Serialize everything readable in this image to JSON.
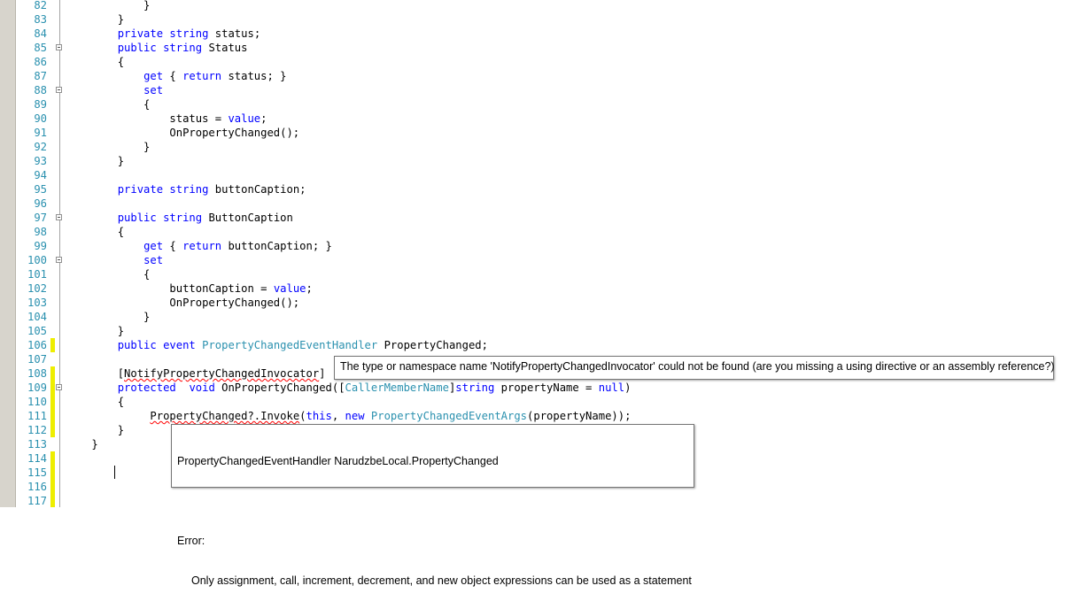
{
  "editor": {
    "lines": [
      {
        "n": "82",
        "s": [
          {
            "t": "            }"
          }
        ]
      },
      {
        "n": "83",
        "s": [
          {
            "t": "        }"
          }
        ]
      },
      {
        "n": "84",
        "s": [
          {
            "t": "        "
          },
          {
            "t": "private",
            "c": "kw"
          },
          {
            "t": " "
          },
          {
            "t": "string",
            "c": "kw"
          },
          {
            "t": " status;"
          }
        ]
      },
      {
        "n": "85",
        "fold": true,
        "s": [
          {
            "t": "        "
          },
          {
            "t": "public",
            "c": "kw"
          },
          {
            "t": " "
          },
          {
            "t": "string",
            "c": "kw"
          },
          {
            "t": " Status"
          }
        ]
      },
      {
        "n": "86",
        "s": [
          {
            "t": "        {"
          }
        ]
      },
      {
        "n": "87",
        "s": [
          {
            "t": "            "
          },
          {
            "t": "get",
            "c": "kw"
          },
          {
            "t": " { "
          },
          {
            "t": "return",
            "c": "kw"
          },
          {
            "t": " status; }"
          }
        ]
      },
      {
        "n": "88",
        "fold": true,
        "s": [
          {
            "t": "            "
          },
          {
            "t": "set",
            "c": "kw"
          }
        ]
      },
      {
        "n": "89",
        "s": [
          {
            "t": "            {"
          }
        ]
      },
      {
        "n": "90",
        "s": [
          {
            "t": "                status = "
          },
          {
            "t": "value",
            "c": "kw"
          },
          {
            "t": ";"
          }
        ]
      },
      {
        "n": "91",
        "s": [
          {
            "t": "                OnPropertyChanged();"
          }
        ]
      },
      {
        "n": "92",
        "s": [
          {
            "t": "            }"
          }
        ]
      },
      {
        "n": "93",
        "s": [
          {
            "t": "        }"
          }
        ]
      },
      {
        "n": "94",
        "s": [
          {
            "t": ""
          }
        ]
      },
      {
        "n": "95",
        "s": [
          {
            "t": "        "
          },
          {
            "t": "private",
            "c": "kw"
          },
          {
            "t": " "
          },
          {
            "t": "string",
            "c": "kw"
          },
          {
            "t": " buttonCaption;"
          }
        ]
      },
      {
        "n": "96",
        "s": [
          {
            "t": ""
          }
        ]
      },
      {
        "n": "97",
        "fold": true,
        "s": [
          {
            "t": "        "
          },
          {
            "t": "public",
            "c": "kw"
          },
          {
            "t": " "
          },
          {
            "t": "string",
            "c": "kw"
          },
          {
            "t": " ButtonCaption"
          }
        ]
      },
      {
        "n": "98",
        "s": [
          {
            "t": "        {"
          }
        ]
      },
      {
        "n": "99",
        "s": [
          {
            "t": "            "
          },
          {
            "t": "get",
            "c": "kw"
          },
          {
            "t": " { "
          },
          {
            "t": "return",
            "c": "kw"
          },
          {
            "t": " buttonCaption; }"
          }
        ]
      },
      {
        "n": "100",
        "fold": true,
        "s": [
          {
            "t": "            "
          },
          {
            "t": "set",
            "c": "kw"
          }
        ]
      },
      {
        "n": "101",
        "s": [
          {
            "t": "            {"
          }
        ]
      },
      {
        "n": "102",
        "s": [
          {
            "t": "                buttonCaption = "
          },
          {
            "t": "value",
            "c": "kw"
          },
          {
            "t": ";"
          }
        ]
      },
      {
        "n": "103",
        "s": [
          {
            "t": "                OnPropertyChanged();"
          }
        ]
      },
      {
        "n": "104",
        "s": [
          {
            "t": "            }"
          }
        ]
      },
      {
        "n": "105",
        "s": [
          {
            "t": "        }"
          }
        ]
      },
      {
        "n": "106",
        "chg": true,
        "s": [
          {
            "t": "        "
          },
          {
            "t": "public",
            "c": "kw"
          },
          {
            "t": " "
          },
          {
            "t": "event",
            "c": "kw"
          },
          {
            "t": " "
          },
          {
            "t": "PropertyChangedEventHandler",
            "c": "ty"
          },
          {
            "t": " PropertyChanged;"
          }
        ]
      },
      {
        "n": "107",
        "s": [
          {
            "t": ""
          }
        ]
      },
      {
        "n": "108",
        "chg": true,
        "s": [
          {
            "t": "        ["
          },
          {
            "t": "NotifyPropertyChangedInvocator",
            "c": "sq"
          },
          {
            "t": "]"
          }
        ]
      },
      {
        "n": "109",
        "chg": true,
        "fold": true,
        "s": [
          {
            "t": "        "
          },
          {
            "t": "protected",
            "c": "kw"
          },
          {
            "t": "  "
          },
          {
            "t": "void",
            "c": "kw"
          },
          {
            "t": " OnPropertyChanged(["
          },
          {
            "t": "CallerMemberName",
            "c": "ty"
          },
          {
            "t": "]"
          },
          {
            "t": "string",
            "c": "kw"
          },
          {
            "t": " propertyName = "
          },
          {
            "t": "null",
            "c": "kw"
          },
          {
            "t": ")"
          }
        ]
      },
      {
        "n": "110",
        "chg": true,
        "s": [
          {
            "t": "        {"
          }
        ]
      },
      {
        "n": "111",
        "chg": true,
        "s": [
          {
            "t": "             "
          },
          {
            "t": "PropertyChanged?.Invoke",
            "c": "sq"
          },
          {
            "t": "("
          },
          {
            "t": "this",
            "c": "kw"
          },
          {
            "t": ", "
          },
          {
            "t": "new",
            "c": "kw"
          },
          {
            "t": " "
          },
          {
            "t": "PropertyChangedEventArgs",
            "c": "ty"
          },
          {
            "t": "(propertyName));"
          }
        ]
      },
      {
        "n": "112",
        "chg": true,
        "s": [
          {
            "t": "        }"
          }
        ]
      },
      {
        "n": "113",
        "s": [
          {
            "t": "    }"
          }
        ]
      },
      {
        "n": "114",
        "chg": true,
        "s": [
          {
            "t": ""
          }
        ]
      },
      {
        "n": "115",
        "chg": true,
        "s": [
          {
            "t": ""
          }
        ]
      },
      {
        "n": "116",
        "chg": true,
        "s": [
          {
            "t": ""
          }
        ]
      },
      {
        "n": "117",
        "chg": true,
        "s": [
          {
            "t": ""
          }
        ]
      }
    ]
  },
  "tooltips": {
    "attribute_error": "The type or namespace name 'NotifyPropertyChangedInvocator' could not be found (are you missing a using directive or an assembly reference?)",
    "statement_error": {
      "signature": "PropertyChangedEventHandler NarudzbeLocal.PropertyChanged",
      "label": "Error:",
      "message": "Only assignment, call, increment, decrement, and new object expressions can be used as a statement"
    }
  },
  "colors": {
    "keyword": "#0000ff",
    "type": "#2b91af",
    "line_number": "#2b91af",
    "change_marker": "#eeee00",
    "error_squiggle": "#ff0000"
  }
}
